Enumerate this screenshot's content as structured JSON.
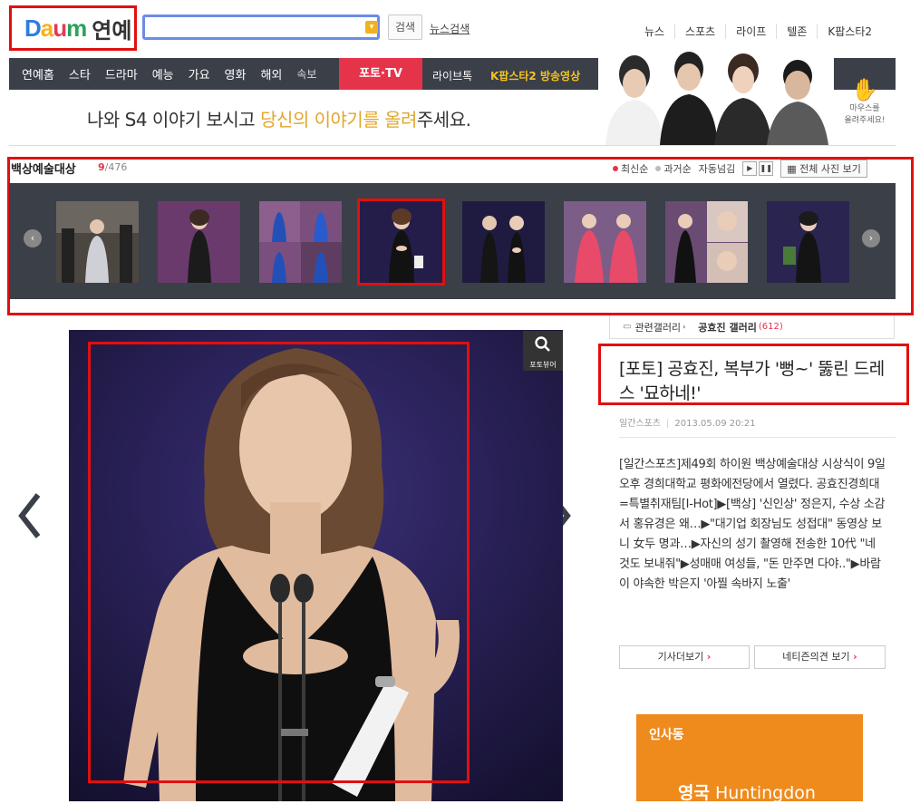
{
  "header": {
    "logo_daum": [
      "D",
      "a",
      "u",
      "m"
    ],
    "logo_section": "연예",
    "search_placeholder": "",
    "search_button": "검색",
    "news_search": "뉴스검색",
    "top_nav": [
      "뉴스",
      "스포츠",
      "라이프",
      "텔존",
      "K팝스타2"
    ]
  },
  "main_nav": {
    "items": [
      "연예홈",
      "스타",
      "드라마",
      "예능",
      "가요",
      "영화",
      "해외",
      "속보"
    ],
    "photo_tv": "포토·TV",
    "live_book": "라이브톡",
    "kpop_video": "K팝스타2 방송영상"
  },
  "banner": {
    "text_before": "나와 S4 이야기 보시고 ",
    "text_highlight": "당신의 이야기를 올려",
    "text_after": "주세요.",
    "hand_label_1": "마우스를",
    "hand_label_2": "올려주세요!"
  },
  "gallery": {
    "title": "백상예술대상",
    "current": "9",
    "total": "/476",
    "sort_latest": "최신순",
    "sort_past": "과거순",
    "auto_play": "자동넘김",
    "view_all": "전체 사진 보기",
    "selected_index": 4,
    "colors": {
      "latest_dot": "#e5344a",
      "past_dot": "#bbbbbb"
    }
  },
  "photo": {
    "viewer_label": "포토뷰어"
  },
  "article": {
    "related_label": "관련갤러리",
    "related_name": "공효진 갤러리",
    "related_count": "(612)",
    "headline": "[포토] 공효진, 복부가 '뻥~' 뚫린 드레스 '묘하네!'",
    "source": "일간스포츠",
    "date": "2013.05.09 20:21",
    "summary": "[일간스포츠]제49회 하이원 백상예술대상 시상식이 9일오후 경희대학교 평화에전당에서 열렸다. 공효진경희대=특별취재팀[I-Hot]▶[백상] '신인상' 정은지, 수상 소감서 홍유경은 왜…▶\"대기업 회장님도 성접대\" 동영상 보니 女두 명과…▶자신의 성기 촬영해 전송한 10代 \"네 것도 보내줘\"▶성매매 여성들, \"돈 만주면 다야..\"▶바람이 야속한 박은지 '아찔 속바지 노출'",
    "more_button": "기사더보기",
    "comments_button": "네티즌의견 보기"
  },
  "ad": {
    "brand": "인사동",
    "title_bold": "영국",
    "title_rest": " Huntingdon"
  }
}
